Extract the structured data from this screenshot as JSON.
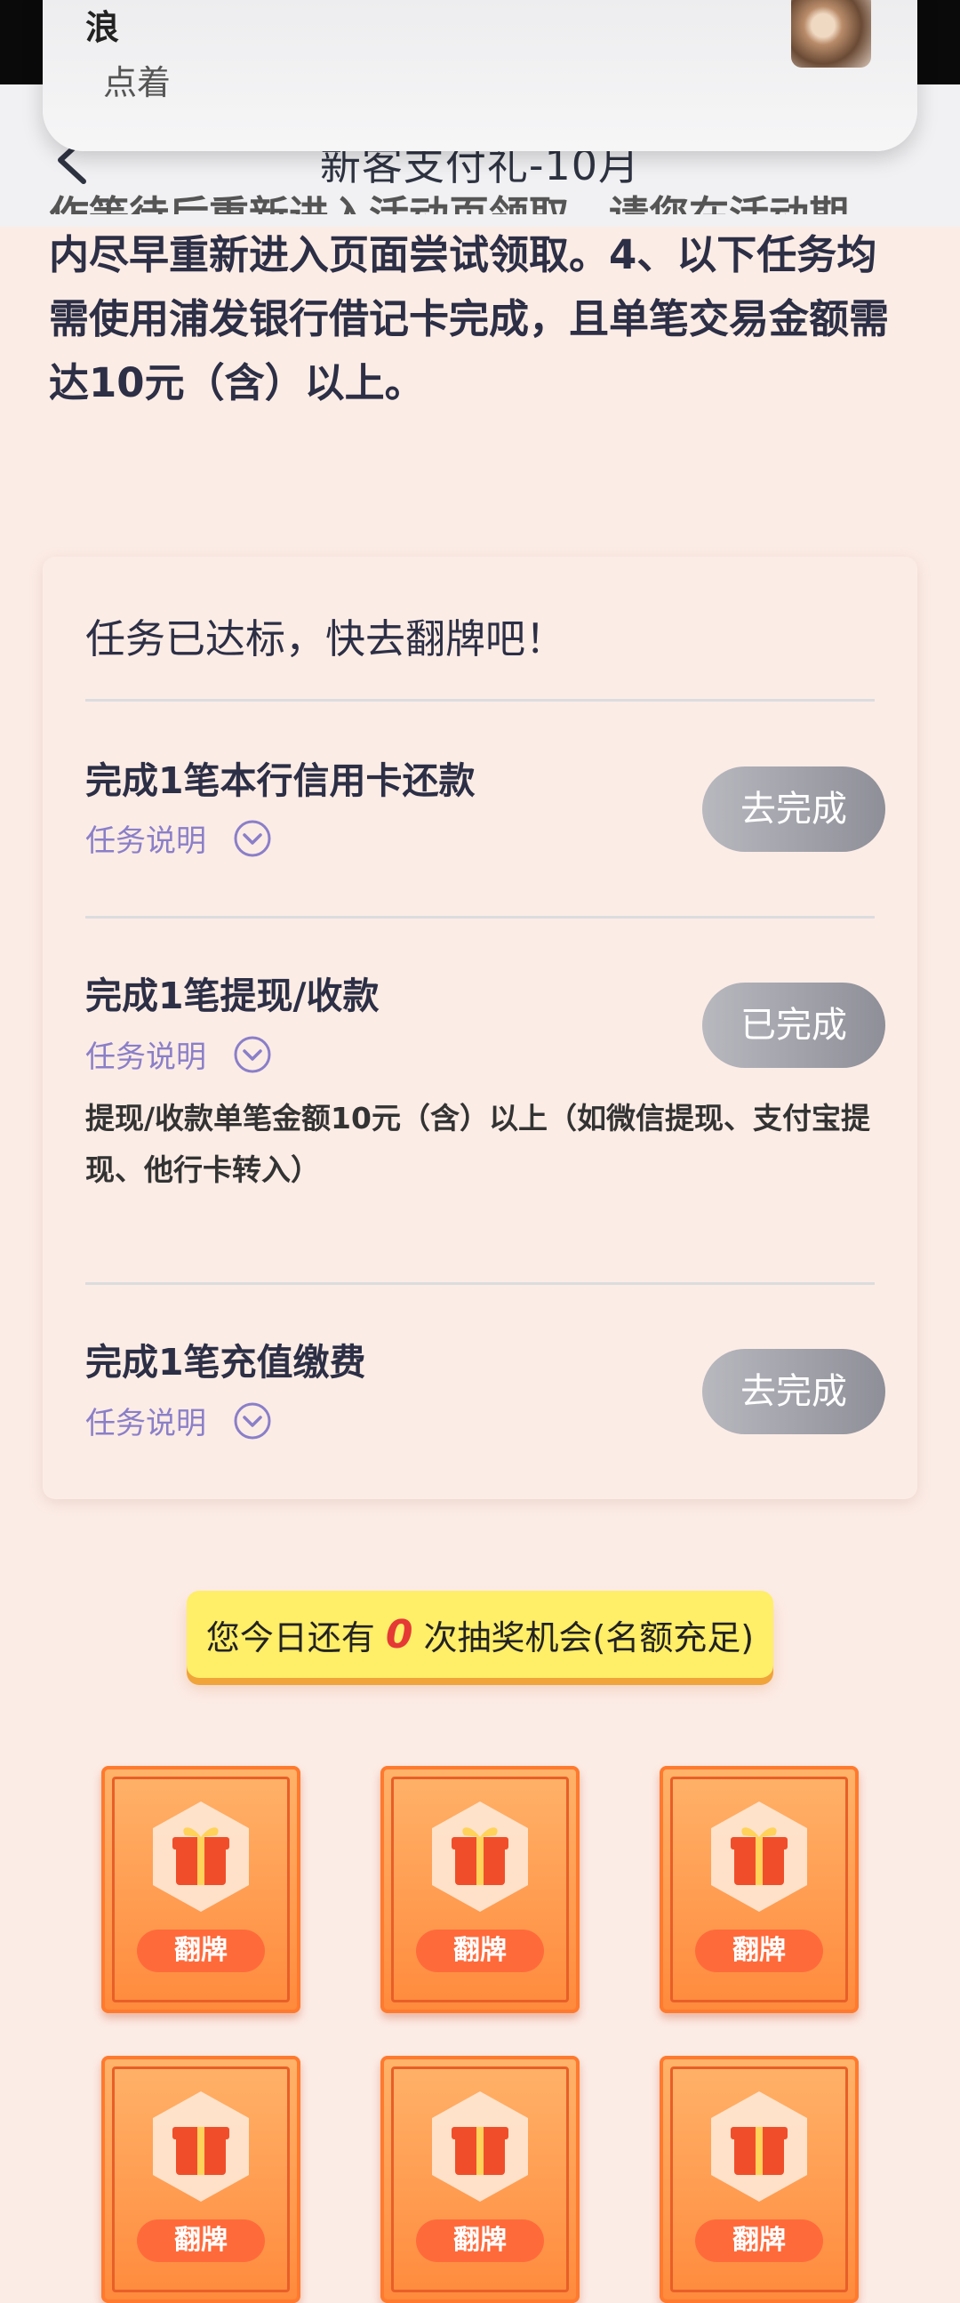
{
  "notification": {
    "title": "浪",
    "body": "点着"
  },
  "header": {
    "title": "新客支付礼-10月"
  },
  "rules": {
    "clipped_line": "作等待后重新进入活动页领取，请您在活动期",
    "text": "内尽早重新进入页面尝试领取。4、以下任务均需使用浦发银行借记卡完成，且单笔交易金额需达10元（含）以上。"
  },
  "tasks_card": {
    "title": "任务已达标，快去翻牌吧！",
    "tasks": [
      {
        "title": "完成1笔本行信用卡还款",
        "explain": "任务说明",
        "button": "去完成"
      },
      {
        "title": "完成1笔提现/收款",
        "explain": "任务说明",
        "button": "已完成",
        "description": "提现/收款单笔金额10元（含）以上（如微信提现、支付宝提现、他行卡转入）"
      },
      {
        "title": "完成1笔充值缴费",
        "explain": "任务说明",
        "button": "去完成"
      }
    ]
  },
  "lottery": {
    "prefix": "您今日还有",
    "count": "0",
    "suffix": "次抽奖机会(名额充足)"
  },
  "flip_cards": [
    {
      "label": "翻牌"
    },
    {
      "label": "翻牌"
    },
    {
      "label": "翻牌"
    },
    {
      "label": "翻牌"
    },
    {
      "label": "翻牌"
    },
    {
      "label": "翻牌"
    }
  ],
  "colors": {
    "page_bg": "#fcece6",
    "accent_purple": "#8a7fc8",
    "button_gray": "#9a9ba3",
    "banner_yellow": "#ffee68",
    "card_orange": "#ff8a3c"
  }
}
